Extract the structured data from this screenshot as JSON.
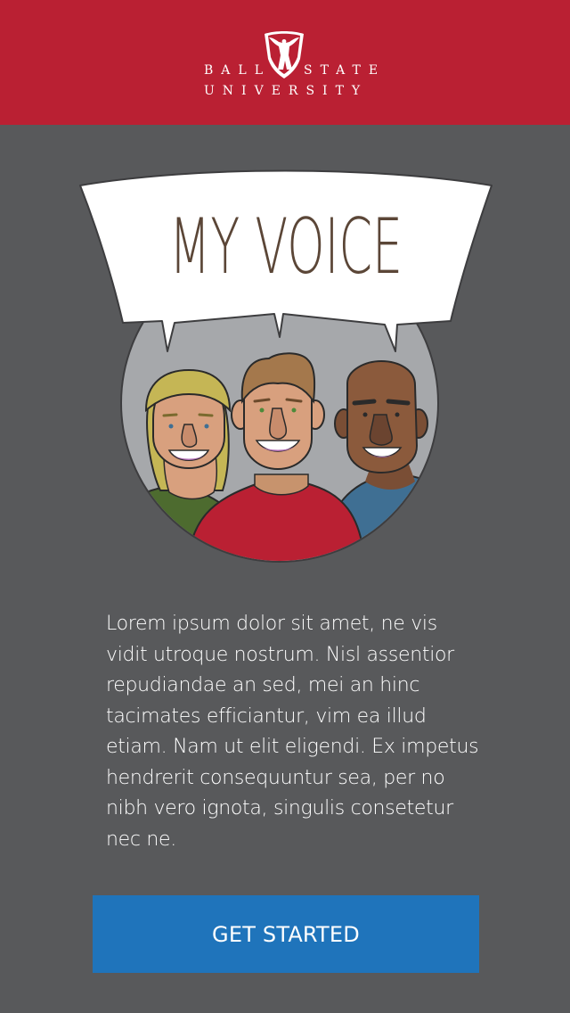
{
  "header": {
    "brand_line1_left": "BALL",
    "brand_line1_right": "STATE",
    "brand_line2": "UNIVERSITY",
    "color": "#ba2033"
  },
  "hero": {
    "title": "MY VOICE",
    "illustration": "three-smiling-people-in-circle",
    "title_color": "#5b4637"
  },
  "intro": {
    "text": "Lorem ipsum dolor sit amet, ne vis vidit utroque nostrum. Nisl assentior repudiandae an sed, mei an hinc tacimates efficiantur, vim ea illud etiam. Nam ut elit eligendi. Ex impetus hendrerit consequuntur sea, per no nibh vero ignota, singulis consetetur nec ne."
  },
  "cta": {
    "label": "GET STARTED",
    "color": "#1f74bb"
  },
  "colors": {
    "background": "#58595b",
    "text": "#ffffff"
  }
}
